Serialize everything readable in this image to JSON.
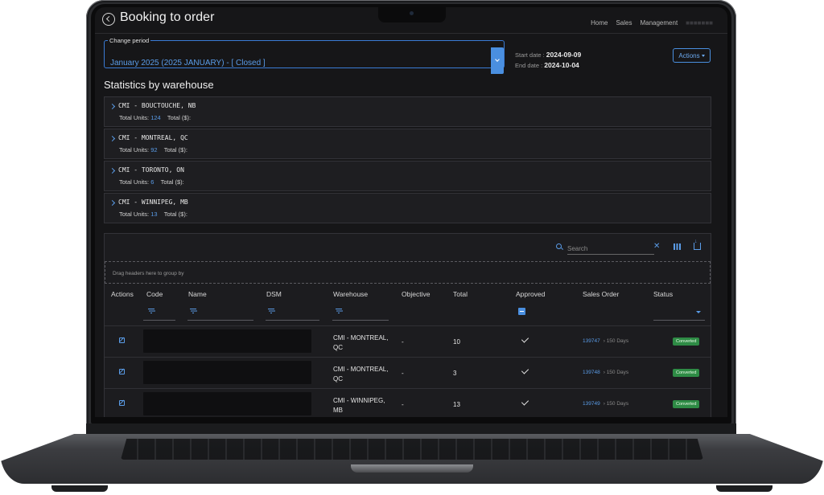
{
  "app": {
    "title": "Booking to order"
  },
  "nav": {
    "items": [
      "Home",
      "Sales",
      "Management"
    ]
  },
  "period": {
    "legend": "Change period",
    "value": "January 2025 (2025 JANUARY) - [ Closed ]"
  },
  "dates": {
    "start_label": "Start date :",
    "start_value": "2024-09-09",
    "end_label": "End date :",
    "end_value": "2024-10-04"
  },
  "actions_label": "Actions",
  "stats": {
    "title": "Statistics by warehouse",
    "units_label": "Total Units:",
    "total_label": "Total ($):",
    "warehouses": [
      {
        "name": "CMI - BOUCTOUCHE, NB",
        "units": "124"
      },
      {
        "name": "CMI - MONTREAL, QC",
        "units": "92"
      },
      {
        "name": "CMI - TORONTO, ON",
        "units": "6"
      },
      {
        "name": "CMI - WINNIPEG, MB",
        "units": "13"
      }
    ]
  },
  "grid": {
    "search_placeholder": "Search",
    "group_hint": "Drag headers here to group by",
    "headers": [
      "Actions",
      "Code",
      "Name",
      "DSM",
      "Warehouse",
      "Objective",
      "Total",
      "Approved",
      "Sales Order",
      "Status"
    ],
    "rows": [
      {
        "warehouse_1": "CMI - MONTREAL,",
        "warehouse_2": "QC",
        "objective": "-",
        "total": "10",
        "order": "139747",
        "days": "150 Days",
        "status": "Converted"
      },
      {
        "warehouse_1": "CMI - MONTREAL,",
        "warehouse_2": "QC",
        "objective": "-",
        "total": "3",
        "order": "139748",
        "days": "150 Days",
        "status": "Converted"
      },
      {
        "warehouse_1": "CMI - WINNIPEG,",
        "warehouse_2": "MB",
        "objective": "-",
        "total": "13",
        "order": "139749",
        "days": "150 Days",
        "status": "Converted"
      }
    ]
  },
  "colors": {
    "accent": "#4a8fe0",
    "background": "#161618",
    "success": "#2e8b45"
  }
}
